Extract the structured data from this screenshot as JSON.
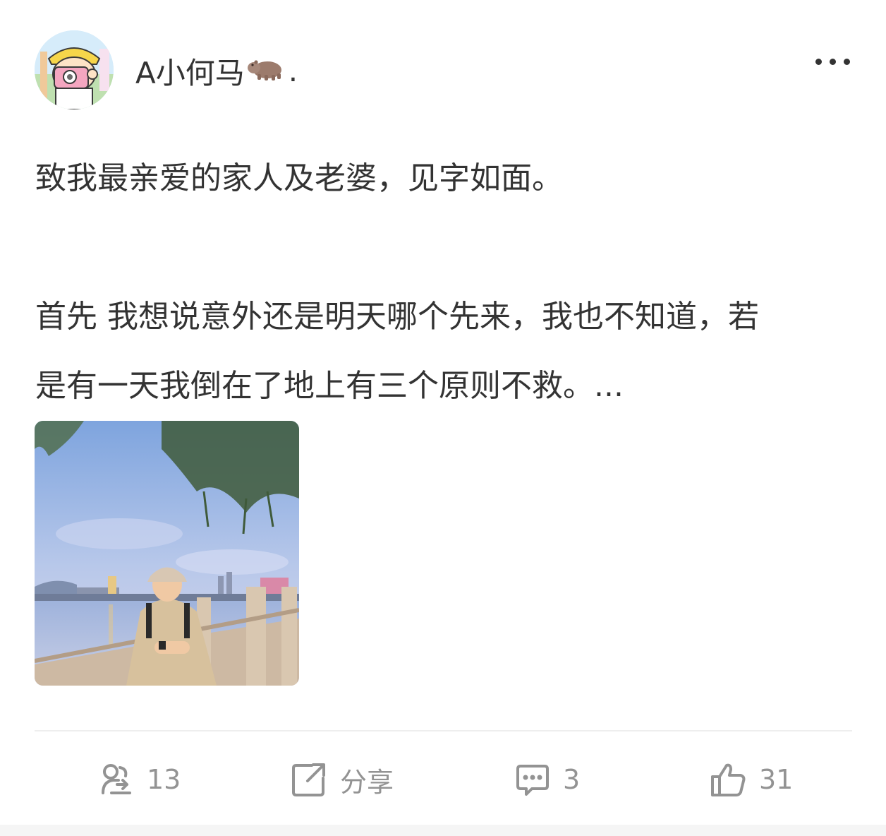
{
  "user": {
    "name": "A小何马",
    "name_suffix": ".",
    "avatar_icon": "cartoon-avatar-with-camera",
    "name_emoji_icon": "hippo-icon"
  },
  "post": {
    "lines": [
      "致我最亲爱的家人及老婆，见字如面。",
      "首先 我想说意外还是明天哪个先来，我也不知道，若",
      "是有一天我倒在了地上有三个原则不救。..."
    ],
    "image_icon": "photo-man-by-river"
  },
  "actions": {
    "forward": {
      "icon": "forward-icon",
      "label": "13"
    },
    "share": {
      "icon": "share-icon",
      "label": "分享"
    },
    "comment": {
      "icon": "comment-icon",
      "label": "3"
    },
    "like": {
      "icon": "thumbs-up-icon",
      "label": "31"
    }
  },
  "colors": {
    "text": "#333333",
    "action_text": "#939393",
    "divider": "#eeeeee"
  }
}
